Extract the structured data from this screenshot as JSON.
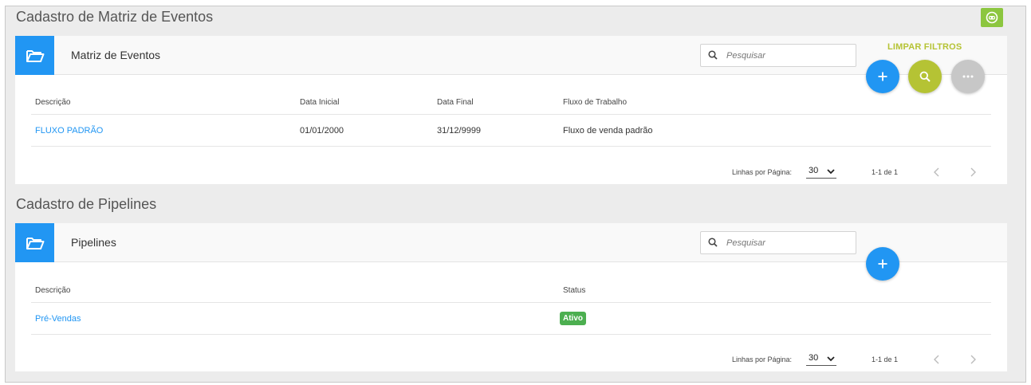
{
  "sections": [
    {
      "title": "Cadastro de Matriz de Eventos",
      "card_title": "Matriz de Eventos",
      "search_placeholder": "Pesquisar",
      "clear_filters_label": "LIMPAR FILTROS",
      "actions": [
        "add",
        "search",
        "more"
      ],
      "columns": [
        "Descrição",
        "Data Inicial",
        "Data Final",
        "Fluxo de Trabalho"
      ],
      "rows": [
        {
          "descricao": "FLUXO PADRÃO",
          "data_inicial": "01/01/2000",
          "data_final": "31/12/9999",
          "fluxo": "Fluxo de venda padrão"
        }
      ],
      "pager": {
        "rows_label": "Linhas por Página:",
        "rows_value": "30",
        "range": "1-1 de 1"
      }
    },
    {
      "title": "Cadastro de Pipelines",
      "card_title": "Pipelines",
      "search_placeholder": "Pesquisar",
      "actions": [
        "add"
      ],
      "columns": [
        "Descrição",
        "Status"
      ],
      "rows": [
        {
          "descricao": "Pré-Vendas",
          "status": "Ativo"
        }
      ],
      "pager": {
        "rows_label": "Linhas por Página:",
        "rows_value": "30",
        "range": "1-1 de 1"
      }
    }
  ],
  "icons": {
    "folder": "folder-open-icon",
    "search": "search-icon",
    "add": "plus-icon",
    "more": "ellipsis-icon",
    "robot": "robot-icon",
    "prev": "chevron-left-icon",
    "next": "chevron-right-icon",
    "dropdown": "chevron-down-icon"
  },
  "colors": {
    "primary": "#2196f3",
    "lime": "#b5c334",
    "robot_bg": "#8cc63f",
    "status_active": "#4caf50",
    "more_gray": "#c7c7c7"
  }
}
